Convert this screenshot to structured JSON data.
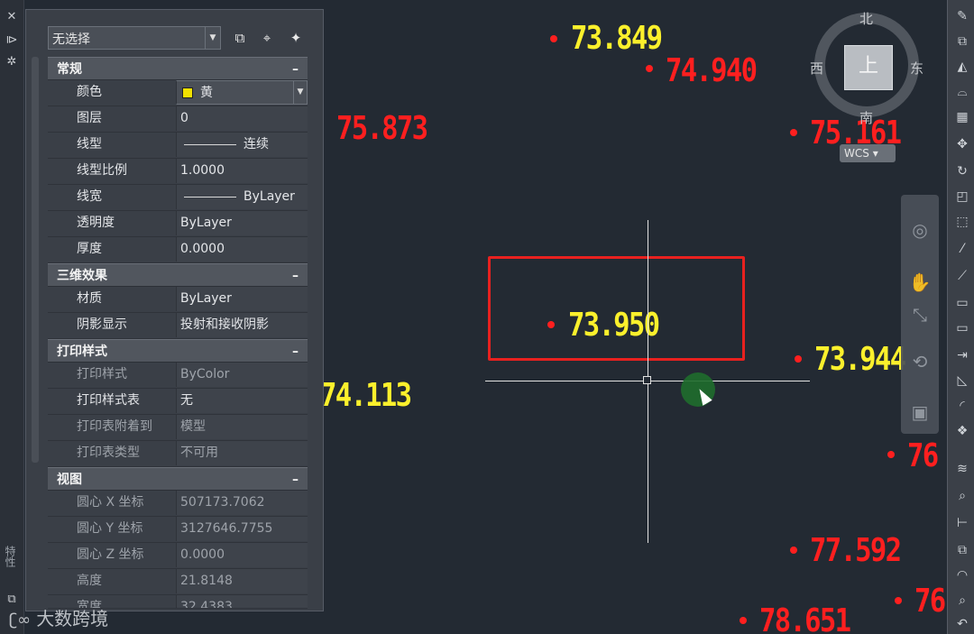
{
  "palette": {
    "selection_value": "无选择",
    "sections": [
      {
        "title": "常规",
        "collapse": "–",
        "rows": [
          {
            "key": "颜色",
            "value": "黄",
            "swatch": "#f3e200"
          },
          {
            "key": "图层",
            "value": "0"
          },
          {
            "key": "线型",
            "value": "连续",
            "line": true
          },
          {
            "key": "线型比例",
            "value": "1.0000"
          },
          {
            "key": "线宽",
            "value": "ByLayer",
            "line": true
          },
          {
            "key": "透明度",
            "value": "ByLayer"
          },
          {
            "key": "厚度",
            "value": "0.0000"
          }
        ]
      },
      {
        "title": "三维效果",
        "collapse": "–",
        "rows": [
          {
            "key": "材质",
            "value": "ByLayer"
          },
          {
            "key": "阴影显示",
            "value": "投射和接收阴影"
          }
        ]
      },
      {
        "title": "打印样式",
        "collapse": "–",
        "rows": [
          {
            "key": "打印样式",
            "value": "ByColor",
            "dim": true
          },
          {
            "key": "打印样式表",
            "value": "无"
          },
          {
            "key": "打印表附着到",
            "value": "模型",
            "dim": true
          },
          {
            "key": "打印表类型",
            "value": "不可用",
            "dim": true
          }
        ]
      },
      {
        "title": "视图",
        "collapse": "–",
        "rows": [
          {
            "key": "圆心 X 坐标",
            "value": "507173.7062",
            "dim": true
          },
          {
            "key": "圆心 Y 坐标",
            "value": "3127646.7755",
            "dim": true
          },
          {
            "key": "圆心 Z 坐标",
            "value": "0.0000",
            "dim": true
          },
          {
            "key": "高度",
            "value": "21.8148",
            "dim": true
          },
          {
            "key": "宽度",
            "value": "32.4383",
            "dim": true
          }
        ]
      }
    ]
  },
  "left_strip": {
    "vertical_label": "特性"
  },
  "elevations": {
    "e1": "73.849",
    "e2": "74.940",
    "e3": "75.873",
    "e4": "75.161",
    "e5": "73.950",
    "e6": "73.944",
    "e7": "74.113",
    "e8": "76",
    "e9": "77.592",
    "e10": "76",
    "e11": "78.651"
  },
  "colors": {
    "red_text": "#ff1f1f",
    "yellow_text": "#fbf02c",
    "selection_rect": "#e8211f",
    "background": "#232a33"
  },
  "viewcube": {
    "north": "北",
    "south": "南",
    "east": "东",
    "west": "西",
    "face": "上",
    "wcs": "WCS"
  },
  "watermark": {
    "text": "大数跨境"
  }
}
